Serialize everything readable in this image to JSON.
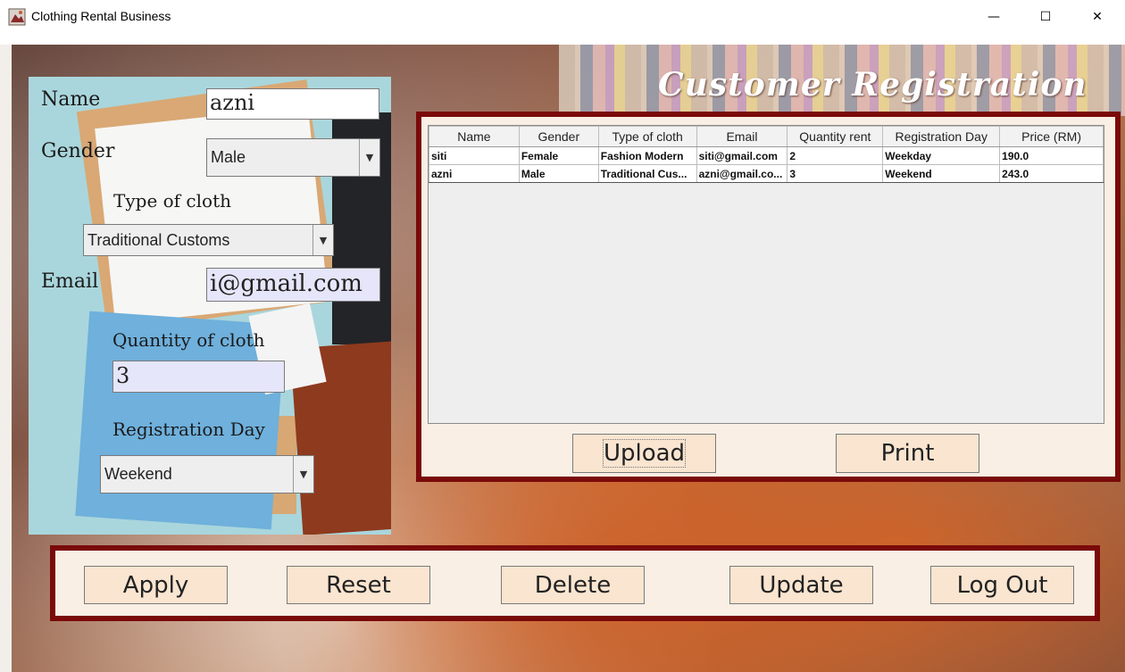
{
  "window": {
    "title": "Clothing Rental Business",
    "controls": {
      "minimize": "—",
      "maximize": "☐",
      "close": "✕"
    }
  },
  "page_title": "Customer Registration",
  "form": {
    "name_label": "Name",
    "name_value": "azni",
    "gender_label": "Gender",
    "gender_value": "Male",
    "cloth_type_label": "Type of cloth",
    "cloth_type_value": "Traditional Customs",
    "email_label": "Email",
    "email_value": "i@gmail.com",
    "quantity_label": "Quantity of cloth",
    "quantity_value": "3",
    "reg_day_label": "Registration Day",
    "reg_day_value": "Weekend"
  },
  "table": {
    "columns": [
      "Name",
      "Gender",
      "Type of cloth",
      "Email",
      "Quantity rent",
      "Registration Day",
      "Price (RM)"
    ],
    "rows": [
      [
        "siti",
        "Female",
        "Fashion Modern",
        "siti@gmail.com",
        "2",
        "Weekday",
        "190.0"
      ],
      [
        "azni",
        "Male",
        "Traditional Cus...",
        "azni@gmail.co...",
        "3",
        "Weekend",
        "243.0"
      ]
    ]
  },
  "table_buttons": {
    "upload": "Upload",
    "print": "Print"
  },
  "actions": {
    "apply": "Apply",
    "reset": "Reset",
    "delete": "Delete",
    "update": "Update",
    "logout": "Log Out"
  },
  "colors": {
    "panel_border": "#7a0a0a",
    "panel_bg": "#f9efe4",
    "button_bg": "#f9e5d0",
    "text_field_lavender": "#e6e6fa"
  }
}
